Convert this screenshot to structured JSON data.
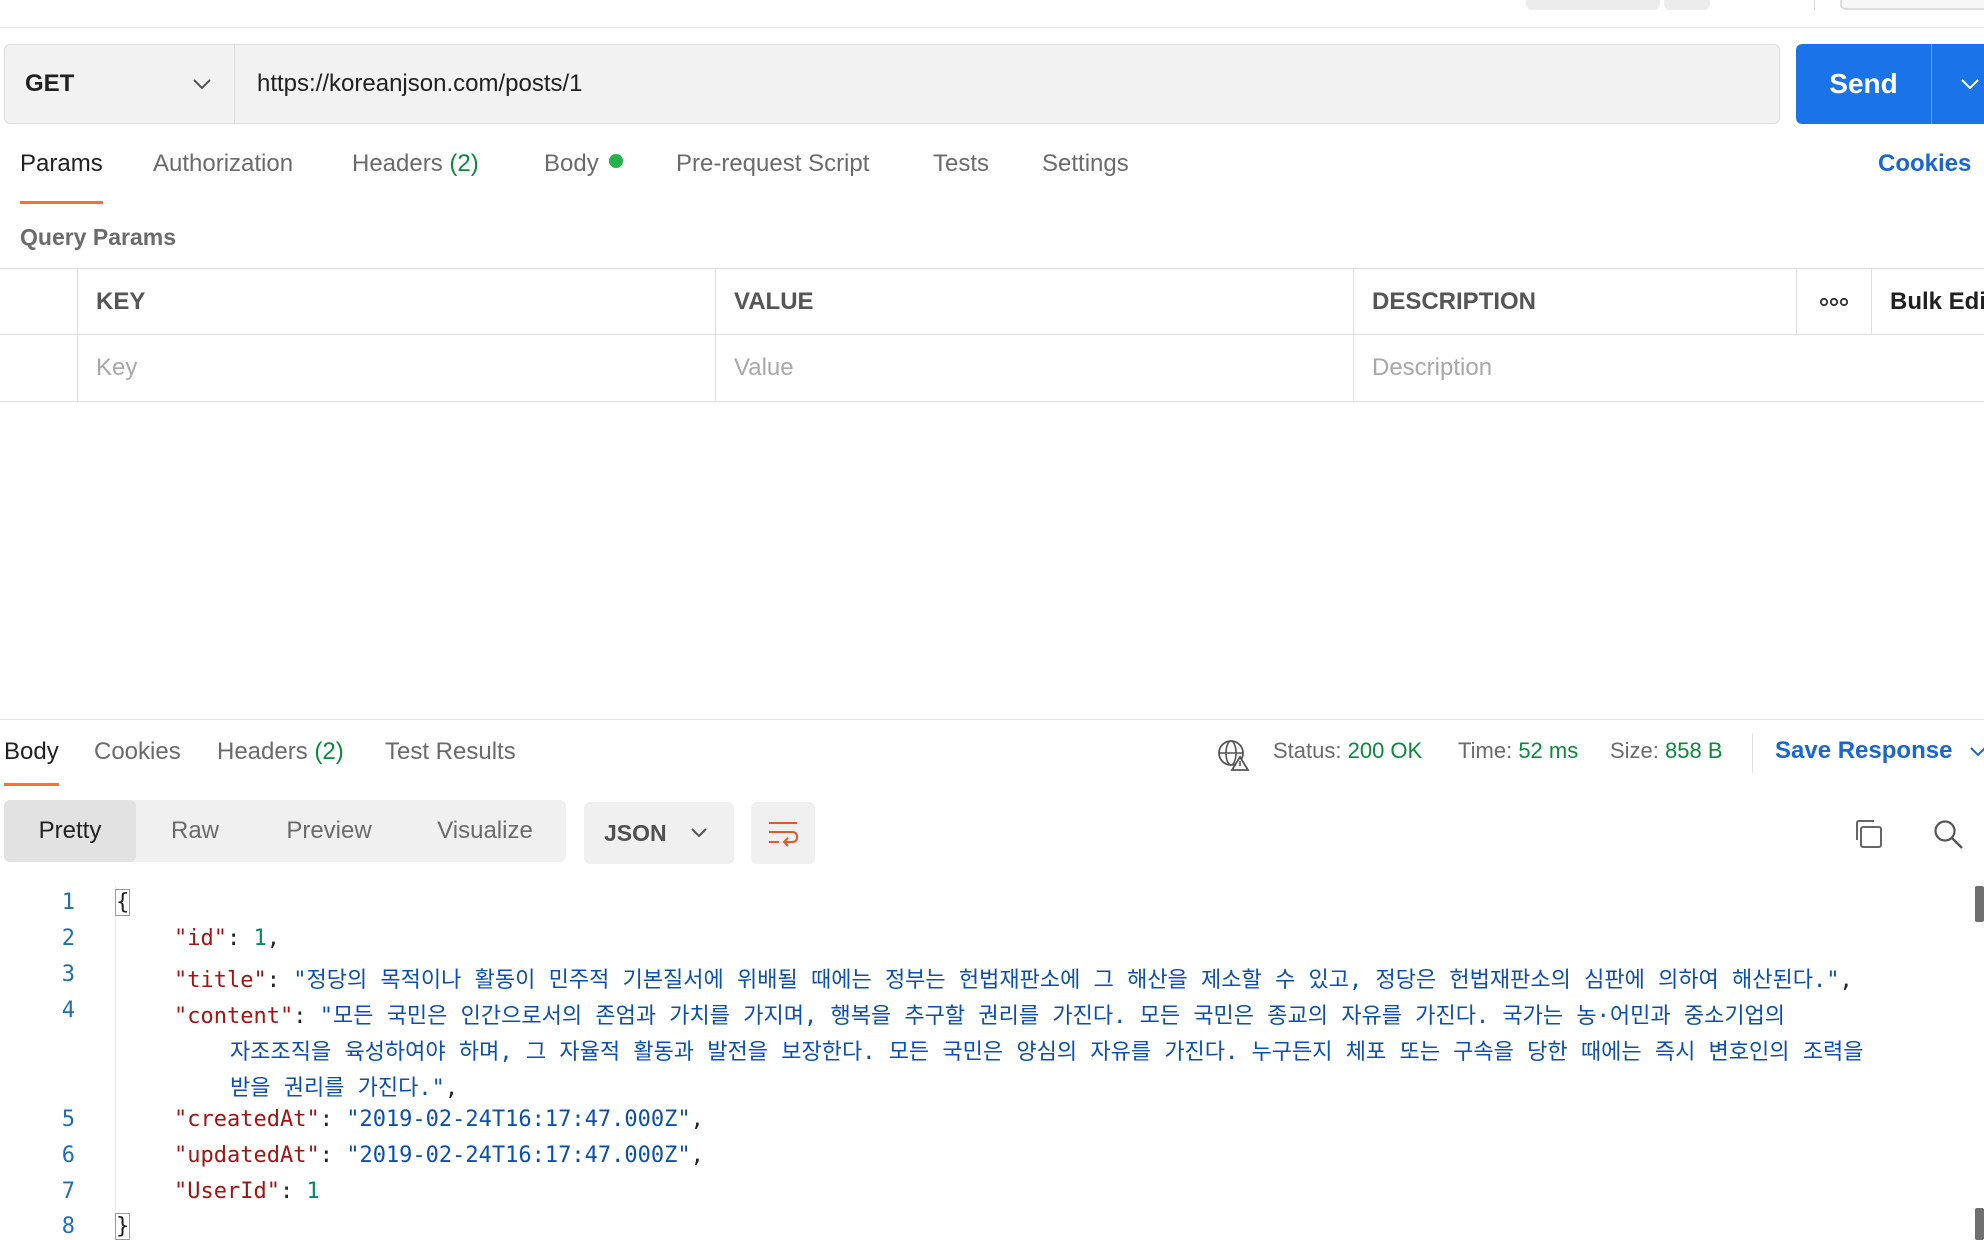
{
  "request": {
    "method": "GET",
    "url": "https://koreanjson.com/posts/1",
    "send_label": "Send"
  },
  "request_tabs": {
    "params": "Params",
    "authorization": "Authorization",
    "headers": "Headers",
    "headers_count": "(2)",
    "body": "Body",
    "prerequest": "Pre-request Script",
    "tests": "Tests",
    "settings": "Settings",
    "cookies": "Cookies"
  },
  "query_params": {
    "title": "Query Params",
    "columns": {
      "key": "KEY",
      "value": "VALUE",
      "description": "DESCRIPTION",
      "bulk_edit": "Bulk Edit"
    },
    "placeholders": {
      "key": "Key",
      "value": "Value",
      "description": "Description"
    }
  },
  "response_tabs": {
    "body": "Body",
    "cookies": "Cookies",
    "headers": "Headers",
    "headers_count": "(2)",
    "test_results": "Test Results"
  },
  "response_status": {
    "status_label": "Status:",
    "status_value": "200 OK",
    "time_label": "Time:",
    "time_value": "52 ms",
    "size_label": "Size:",
    "size_value": "858 B",
    "save_response": "Save Response"
  },
  "view_modes": {
    "pretty": "Pretty",
    "raw": "Raw",
    "preview": "Preview",
    "visualize": "Visualize",
    "format": "JSON"
  },
  "code": {
    "line_numbers": [
      "1",
      "2",
      "3",
      "4",
      "5",
      "6",
      "7",
      "8"
    ],
    "open_brace": "{",
    "close_brace": "}",
    "id_key": "\"id\"",
    "id_value": "1",
    "title_key": "\"title\"",
    "title_value": "\"정당의 목적이나 활동이 민주적 기본질서에 위배될 때에는 정부는 헌법재판소에 그 해산을 제소할 수 있고, 정당은 헌법재판소의 심판에 의하여 해산된다.\"",
    "content_key": "\"content\"",
    "content_value_line1": "\"모든 국민은 인간으로서의 존엄과 가치를 가지며, 행복을 추구할 권리를 가진다. 모든 국민은 종교의 자유를 가진다. 국가는 농·어민과 중소기업의",
    "content_value_line2": "자조조직을 육성하여야 하며, 그 자율적 활동과 발전을 보장한다. 모든 국민은 양심의 자유를 가진다. 누구든지 체포 또는 구속을 당한 때에는 즉시 변호인의 조력을",
    "content_value_line3": "받을 권리를 가진다.\"",
    "created_key": "\"createdAt\"",
    "created_value": "\"2019-02-24T16:17:47.000Z\"",
    "updated_key": "\"updatedAt\"",
    "updated_value": "\"2019-02-24T16:17:47.000Z\"",
    "userid_key": "\"UserId\"",
    "userid_value": "1"
  },
  "icons": {
    "method_dropdown": "chevron-down-icon",
    "send_dropdown": "chevron-down-icon",
    "more": "more-horizontal-icon",
    "globe": "globe-warning-icon",
    "save_dropdown": "chevron-down-icon",
    "format_dropdown": "chevron-down-icon",
    "wrap": "wrap-lines-icon",
    "copy": "copy-icon",
    "search": "search-icon"
  },
  "colors": {
    "accent_orange": "#ff6c37",
    "send_blue": "#1a73e8",
    "link_blue": "#1a66d2",
    "success_green": "#0a8a3a",
    "body_dot_green": "#26b24b",
    "json_key": "#a31515",
    "json_string": "#0b4fb0",
    "json_number": "#09885a"
  }
}
